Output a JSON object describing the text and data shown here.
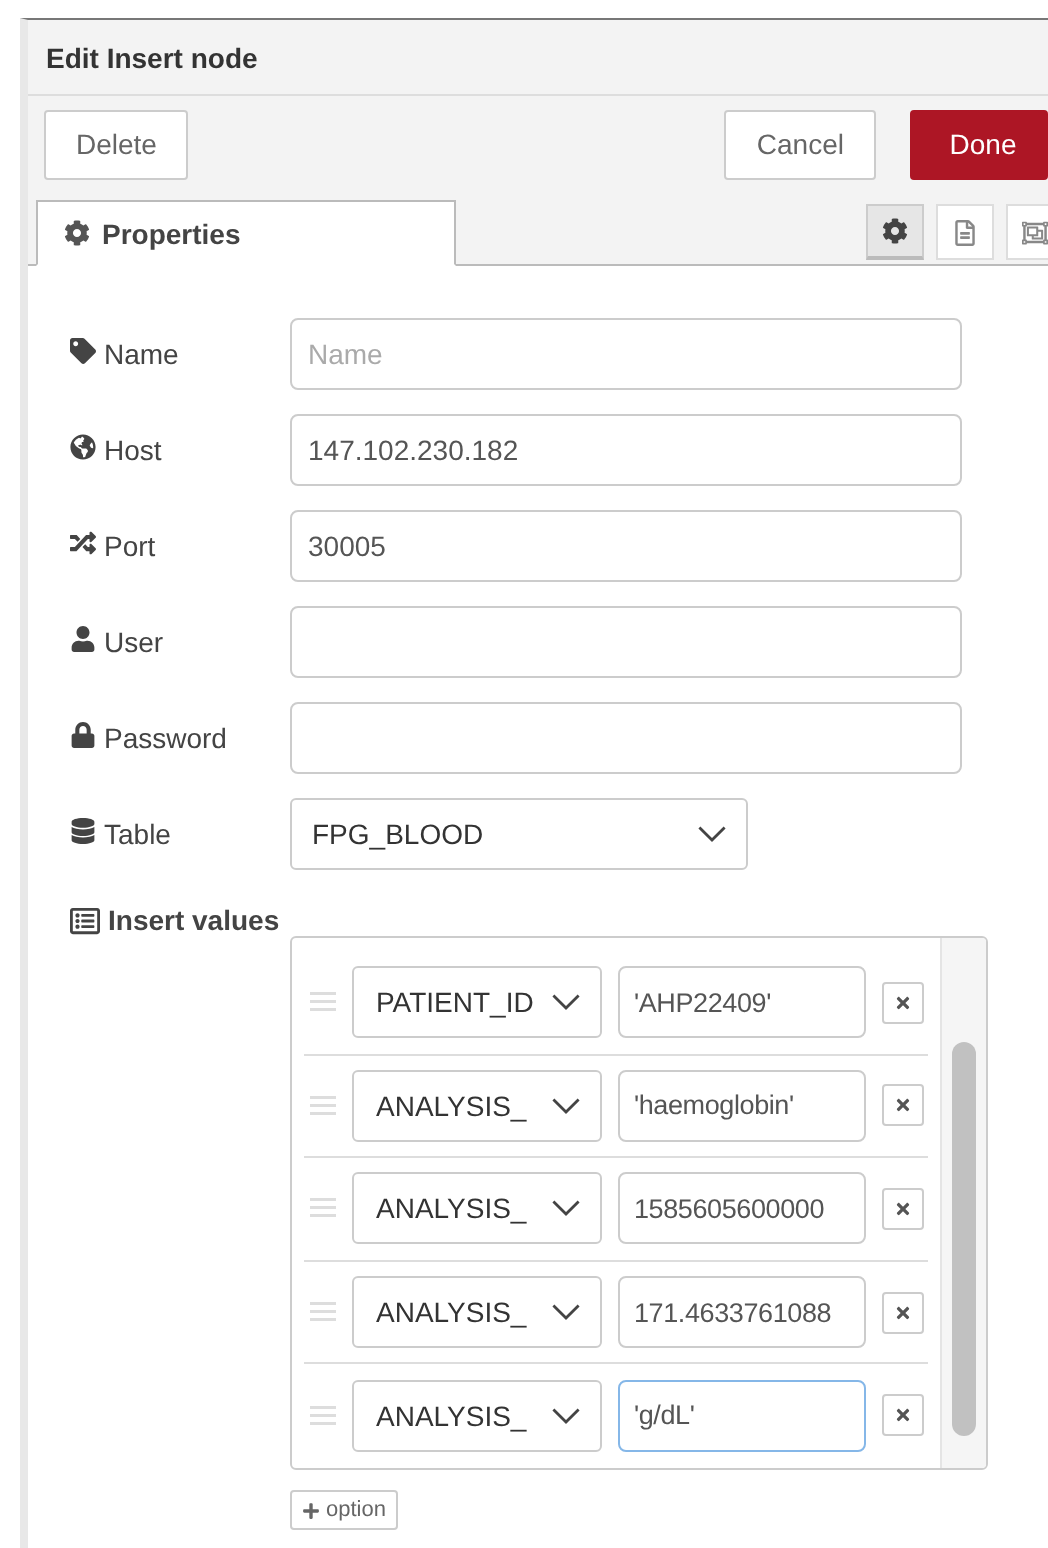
{
  "dialog": {
    "title": "Edit Insert node"
  },
  "buttons": [
    {
      "label": "Delete",
      "kind": "plain"
    },
    {
      "label": "Cancel",
      "kind": "plain"
    },
    {
      "label": "Done",
      "kind": "primary"
    }
  ],
  "tabs": [
    {
      "label": "Properties",
      "selected": true
    }
  ],
  "side_tabs": [
    {
      "selected": true
    },
    {
      "selected": false
    },
    {
      "selected": false
    }
  ],
  "fields": [
    {
      "label": "Name",
      "kind": "input",
      "placeholder": "Name"
    },
    {
      "label": "Host",
      "kind": "input",
      "value": "147.102.230.182"
    },
    {
      "label": "Port",
      "kind": "input",
      "value": "30005"
    },
    {
      "label": "User",
      "kind": "input"
    },
    {
      "label": "Password",
      "kind": "input"
    },
    {
      "label": "Table",
      "kind": "select",
      "value": "FPG_BLOOD"
    }
  ],
  "insert_values": {
    "label": "Insert values",
    "rows": [
      {
        "column": "PATIENT_ID",
        "value": "'AHP22409'",
        "focused": false
      },
      {
        "column": "ANALYSIS_",
        "value": "'haemoglobin'",
        "focused": false
      },
      {
        "column": "ANALYSIS_",
        "value": "1585605600000",
        "focused": false
      },
      {
        "column": "ANALYSIS_",
        "value": "171.4633761088",
        "focused": false
      },
      {
        "column": "ANALYSIS_",
        "value": "'g/dL'",
        "focused": true
      }
    ],
    "add_button": "option"
  }
}
